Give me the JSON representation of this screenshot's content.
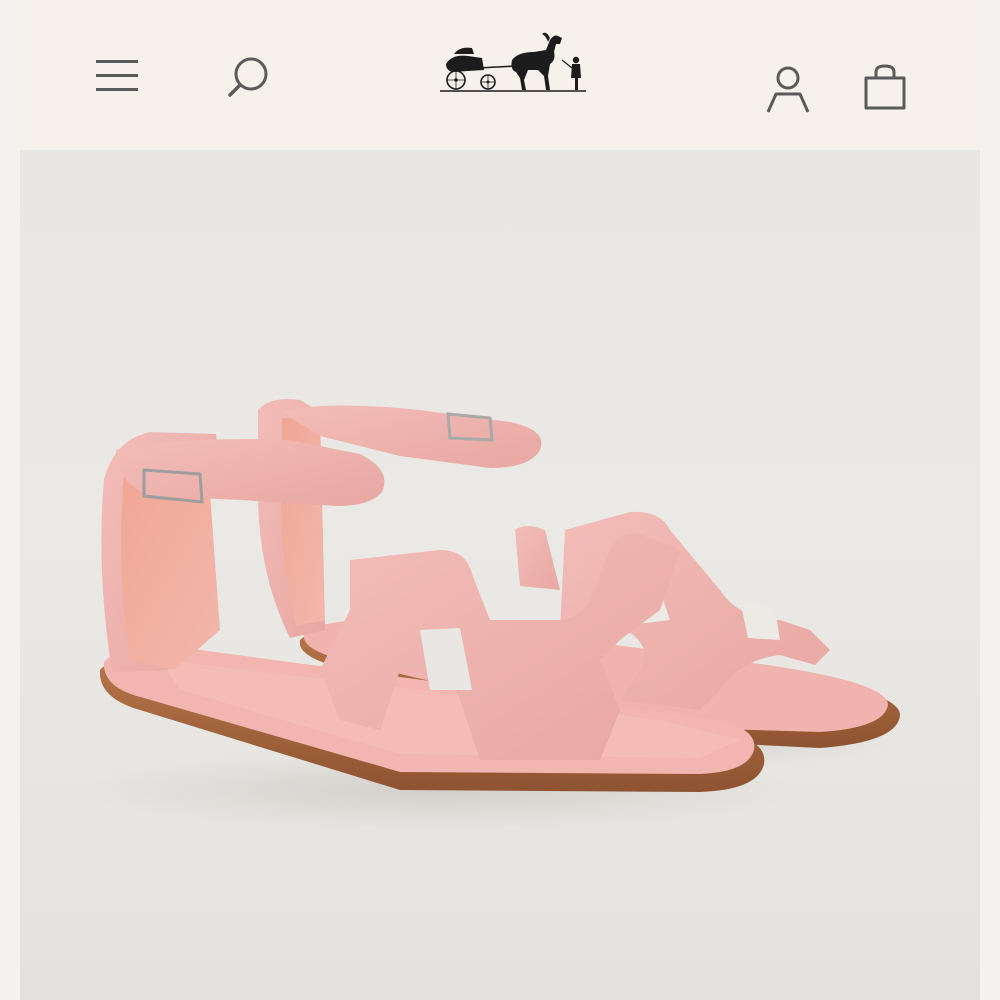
{
  "header": {
    "menu_icon": "hamburger-menu-icon",
    "search_icon": "search-icon",
    "logo": "horse-carriage-logo",
    "account_icon": "user-account-icon",
    "bag_icon": "shopping-bag-icon",
    "colors": {
      "background": "#f6f1ea",
      "icon": "#5a5a5a"
    }
  },
  "product_image": {
    "alt": "product-photo-pink-leather-sandals",
    "colors": {
      "leather": "#efb0ac",
      "sole": "#a8643c",
      "background": "#e9e7e3"
    }
  }
}
